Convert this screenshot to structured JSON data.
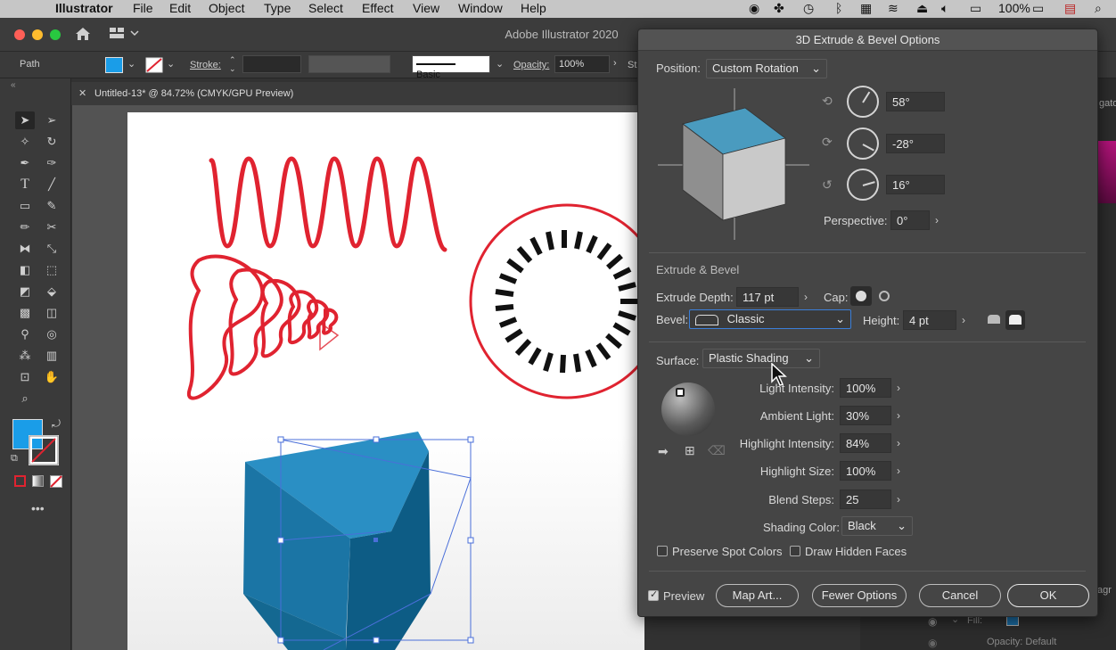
{
  "menubar": {
    "app": "Illustrator",
    "items": [
      "File",
      "Edit",
      "Object",
      "Type",
      "Select",
      "Effect",
      "View",
      "Window",
      "Help"
    ],
    "battery": "100%"
  },
  "app": {
    "title": "Adobe Illustrator 2020"
  },
  "control_bar": {
    "selection": "Path",
    "stroke_label": "Stroke:",
    "brush": "Basic",
    "opacity_label": "Opacity:",
    "opacity_value": "100%",
    "style_label": "St"
  },
  "document_tab": {
    "title": "Untitled-13* @ 84.72% (CMYK/GPU Preview)"
  },
  "right_panel": {
    "fill_label": "Fill:",
    "opacity_text": "Opacity: Default",
    "partial1": "gato",
    "partial2": "agr"
  },
  "dialog": {
    "title": "3D Extrude & Bevel Options",
    "position_label": "Position:",
    "position_value": "Custom Rotation",
    "rot_x": "58°",
    "rot_y": "-28°",
    "rot_z": "16°",
    "perspective_label": "Perspective:",
    "perspective_value": "0°",
    "extrude_section": "Extrude & Bevel",
    "extrude_depth_label": "Extrude Depth:",
    "extrude_depth_value": "117 pt",
    "cap_label": "Cap:",
    "bevel_label": "Bevel:",
    "bevel_value": "Classic",
    "height_label": "Height:",
    "height_value": "4 pt",
    "surface_label": "Surface:",
    "surface_value": "Plastic Shading",
    "light_intensity_label": "Light Intensity:",
    "light_intensity_value": "100%",
    "ambient_light_label": "Ambient Light:",
    "ambient_light_value": "30%",
    "highlight_intensity_label": "Highlight Intensity:",
    "highlight_intensity_value": "84%",
    "highlight_size_label": "Highlight Size:",
    "highlight_size_value": "100%",
    "blend_steps_label": "Blend Steps:",
    "blend_steps_value": "25",
    "shading_color_label": "Shading Color:",
    "shading_color_value": "Black",
    "preserve_spot_label": "Preserve Spot Colors",
    "draw_hidden_label": "Draw Hidden Faces",
    "preview_label": "Preview",
    "preview_checked": true,
    "map_art_label": "Map Art...",
    "fewer_options_label": "Fewer Options",
    "cancel_label": "Cancel",
    "ok_label": "OK"
  },
  "colors": {
    "cube_top": "#4a9bbf",
    "fill_swatch": "#1a9de8",
    "art_red": "#e02330",
    "shape_blue": "#1f7fb0"
  }
}
